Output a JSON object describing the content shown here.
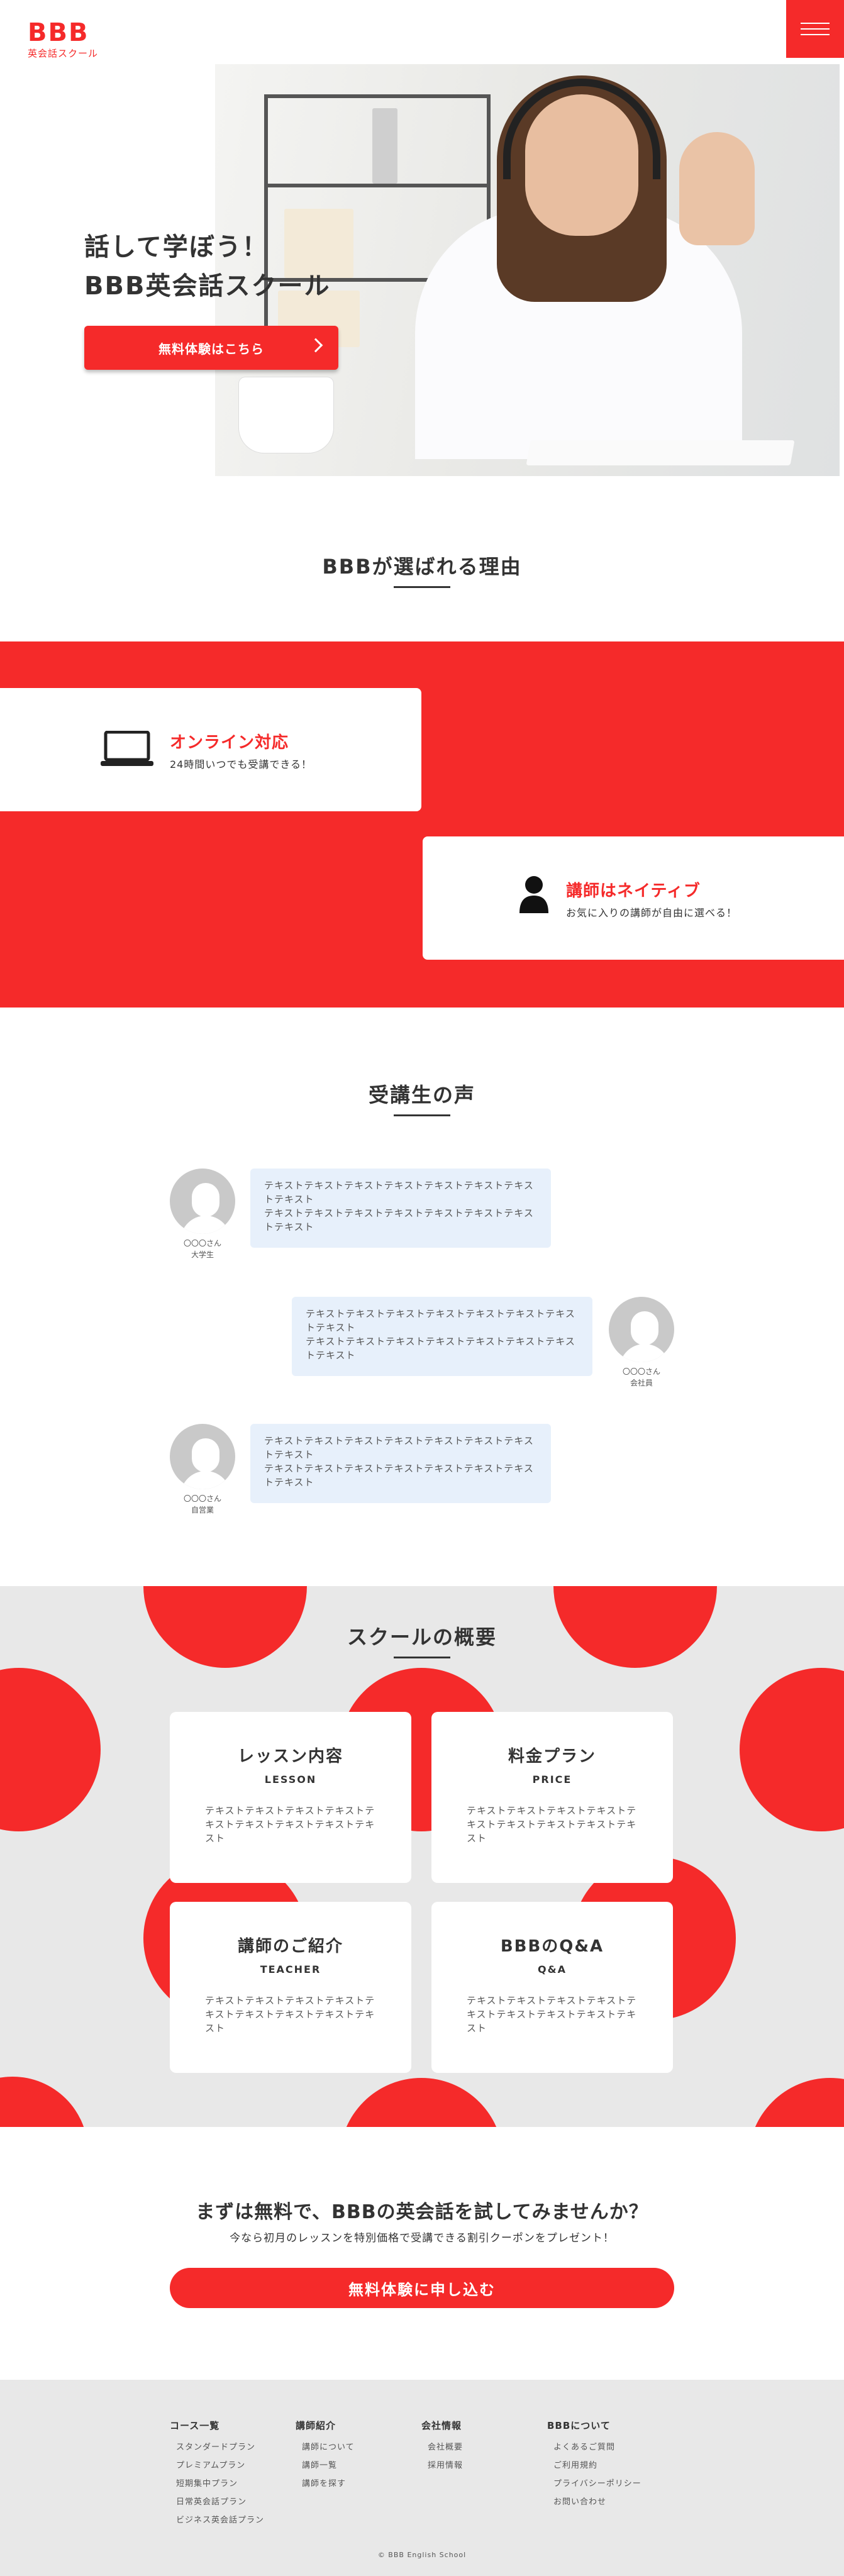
{
  "header": {
    "logo_main": "BBB",
    "logo_sub": "英会話スクール"
  },
  "hero": {
    "heading_line1": "話して学ぼう！",
    "heading_line2": "BBB英会話スクール",
    "cta_label": "無料体験はこちら"
  },
  "reasons": {
    "title": "BBBが選ばれる理由",
    "items": [
      {
        "title": "オンライン対応",
        "desc": "24時間いつでも受講できる！",
        "icon": "laptop-icon"
      },
      {
        "title": "講師はネイティブ",
        "desc": "お気に入りの講師が自由に選べる！",
        "icon": "person-icon"
      }
    ]
  },
  "voices": {
    "title": "受講生の声",
    "items": [
      {
        "name": "〇〇〇さん",
        "role": "大学生",
        "line1": "テキストテキストテキストテキストテキストテキストテキストテキスト",
        "line2": "テキストテキストテキストテキストテキストテキストテキストテキスト"
      },
      {
        "name": "〇〇〇さん",
        "role": "会社員",
        "line1": "テキストテキストテキストテキストテキストテキストテキストテキスト",
        "line2": "テキストテキストテキストテキストテキストテキストテキストテキスト"
      },
      {
        "name": "〇〇〇さん",
        "role": "自営業",
        "line1": "テキストテキストテキストテキストテキストテキストテキストテキスト",
        "line2": "テキストテキストテキストテキストテキストテキストテキストテキスト"
      }
    ]
  },
  "overview": {
    "title": "スクールの概要",
    "cards": [
      {
        "title": "レッスン内容",
        "sub": "LESSON",
        "text": "テキストテキストテキストテキストテキストテキストテキストテキストテキスト"
      },
      {
        "title": "料金プラン",
        "sub": "PRICE",
        "text": "テキストテキストテキストテキストテキストテキストテキストテキストテキスト"
      },
      {
        "title": "講師のご紹介",
        "sub": "TEACHER",
        "text": "テキストテキストテキストテキストテキストテキストテキストテキストテキスト"
      },
      {
        "title": "BBBのQ&A",
        "sub": "Q&A",
        "text": "テキストテキストテキストテキストテキストテキストテキストテキストテキスト"
      }
    ]
  },
  "cta": {
    "heading": "まずは無料で、BBBの英会話を試してみませんか？",
    "sub": "今なら初月のレッスンを特別価格で受講できる割引クーポンをプレゼント！",
    "button": "無料体験に申し込む"
  },
  "footer": {
    "columns": [
      {
        "head": "コース一覧",
        "items": [
          "スタンダードプラン",
          "プレミアムプラン",
          "短期集中プラン",
          "日常英会話プラン",
          "ビジネス英会話プラン"
        ]
      },
      {
        "head": "講師紹介",
        "items": [
          "講師について",
          "講師一覧",
          "講師を探す"
        ]
      },
      {
        "head": "会社情報",
        "items": [
          "会社概要",
          "採用情報"
        ]
      },
      {
        "head": "BBBについて",
        "items": [
          "よくあるご質問",
          "ご利用規約",
          "プライバシーポリシー",
          "お問い合わせ"
        ]
      }
    ],
    "copyright": "© BBB English School"
  },
  "colors": {
    "accent": "#f52a2a",
    "bubble": "#e7f0fb",
    "gray_bg": "#e8e8e8"
  }
}
